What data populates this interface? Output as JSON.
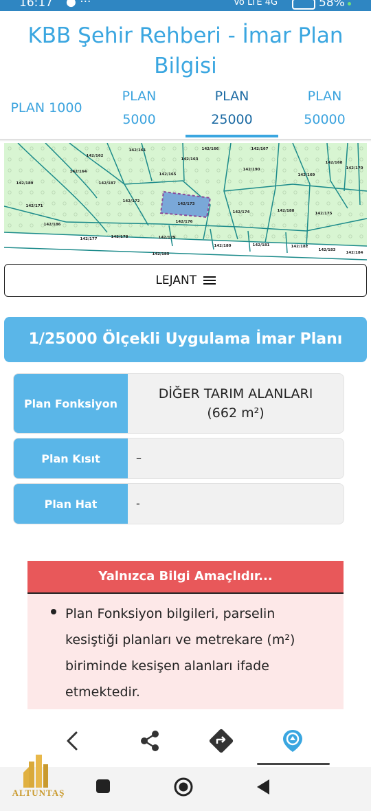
{
  "status_bar": {
    "time": "16:17",
    "battery": "58%",
    "signal": "Vo LTE 4G"
  },
  "app": {
    "title_line1": "KBB Şehir Rehberi - İmar Plan",
    "title_line2": "Bilgisi"
  },
  "tabs": [
    {
      "line1": "PLAN 1000",
      "line2": ""
    },
    {
      "line1": "PLAN",
      "line2": "5000"
    },
    {
      "line1": "PLAN",
      "line2": "25000"
    },
    {
      "line1": "PLAN",
      "line2": "50000"
    }
  ],
  "active_tab": 2,
  "map": {
    "parcel_labels": [
      "142/161",
      "142/162",
      "142/166",
      "142/167",
      "142/163",
      "142/164",
      "142/165",
      "142/168",
      "142/169",
      "142/170",
      "142/171",
      "142/172",
      "142/173",
      "142/174",
      "142/175",
      "142/176",
      "142/177",
      "142/178",
      "142/179",
      "142/180",
      "142/181",
      "142/182",
      "142/183",
      "142/184",
      "142/185",
      "142/186",
      "142/187",
      "142/188",
      "142/189",
      "142/190"
    ],
    "colors": {
      "land": "#d8f5d2",
      "road": "#ffffff",
      "parcel_line": "#1b8a8a",
      "selected_fill": "#7aa8d8",
      "selected_border": "#8a4a9a"
    }
  },
  "legend_button": {
    "label": "LEJANT",
    "icon": "menu-icon"
  },
  "section_title": "1/25000 Ölçekli Uygulama İmar Planı",
  "info_rows": [
    {
      "label": "Plan Fonksiyon",
      "value_line1": "DİĞER TARIM ALANLARI",
      "value_line2": "(662 m²)"
    },
    {
      "label": "Plan Kısıt",
      "value_line1": "–",
      "value_line2": ""
    },
    {
      "label": "Plan Hat",
      "value_line1": "-",
      "value_line2": ""
    }
  ],
  "warning": {
    "title": "Yalnızca Bilgi Amaçlıdır...",
    "body": "Plan Fonksiyon bilgileri, parselin kesiştiği planları ve metrekare (m²) biriminde kesişen alanları ifade etmektedir."
  },
  "toolbar": [
    "back-icon",
    "share-icon",
    "directions-icon",
    "location-icon"
  ],
  "watermark": {
    "brand": "ALTUNTAŞ"
  },
  "theme": {
    "primary": "#5ab6e8",
    "title_blue": "#3aa6e0",
    "warning_red": "#e8585a",
    "warning_bg": "#fde8e8"
  }
}
